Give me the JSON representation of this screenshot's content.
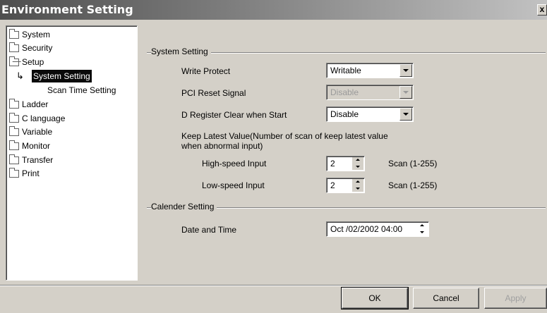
{
  "window": {
    "title": "Environment Setting",
    "close_label": "x"
  },
  "tree": {
    "items": [
      {
        "label": "System",
        "icon": "folder-icon"
      },
      {
        "label": "Security",
        "icon": "folder-icon"
      },
      {
        "label": "Setup",
        "icon": "folder-open-icon"
      },
      {
        "label": "System Setting",
        "icon": "arrow-icon",
        "selected": true
      },
      {
        "label": "Scan Time Setting"
      },
      {
        "label": "Ladder",
        "icon": "folder-icon"
      },
      {
        "label": "C language",
        "icon": "folder-icon"
      },
      {
        "label": "Variable",
        "icon": "folder-icon"
      },
      {
        "label": "Monitor",
        "icon": "folder-icon"
      },
      {
        "label": "Transfer",
        "icon": "folder-icon"
      },
      {
        "label": "Print",
        "icon": "folder-icon"
      }
    ]
  },
  "system_setting": {
    "group_label": "System Setting",
    "write_protect": {
      "label": "Write Protect",
      "value": "Writable"
    },
    "pci_reset": {
      "label": "PCI Reset Signal",
      "value": "Disable"
    },
    "d_register": {
      "label": "D Register Clear when Start",
      "value": "Disable"
    },
    "keep_latest": {
      "label_line1": "Keep Latest Value(Number of scan of keep latest value",
      "label_line2": "when abnormal input)",
      "high_speed": {
        "label": "High-speed Input",
        "value": "2",
        "unit": "Scan (1-255)"
      },
      "low_speed": {
        "label": "Low-speed Input",
        "value": "2",
        "unit": "Scan (1-255)"
      }
    }
  },
  "calender_setting": {
    "group_label": "Calender Setting",
    "date_time": {
      "label": "Date and Time",
      "value": "Oct /02/2002 04:00"
    }
  },
  "buttons": {
    "ok": "OK",
    "cancel": "Cancel",
    "apply": "Apply"
  }
}
